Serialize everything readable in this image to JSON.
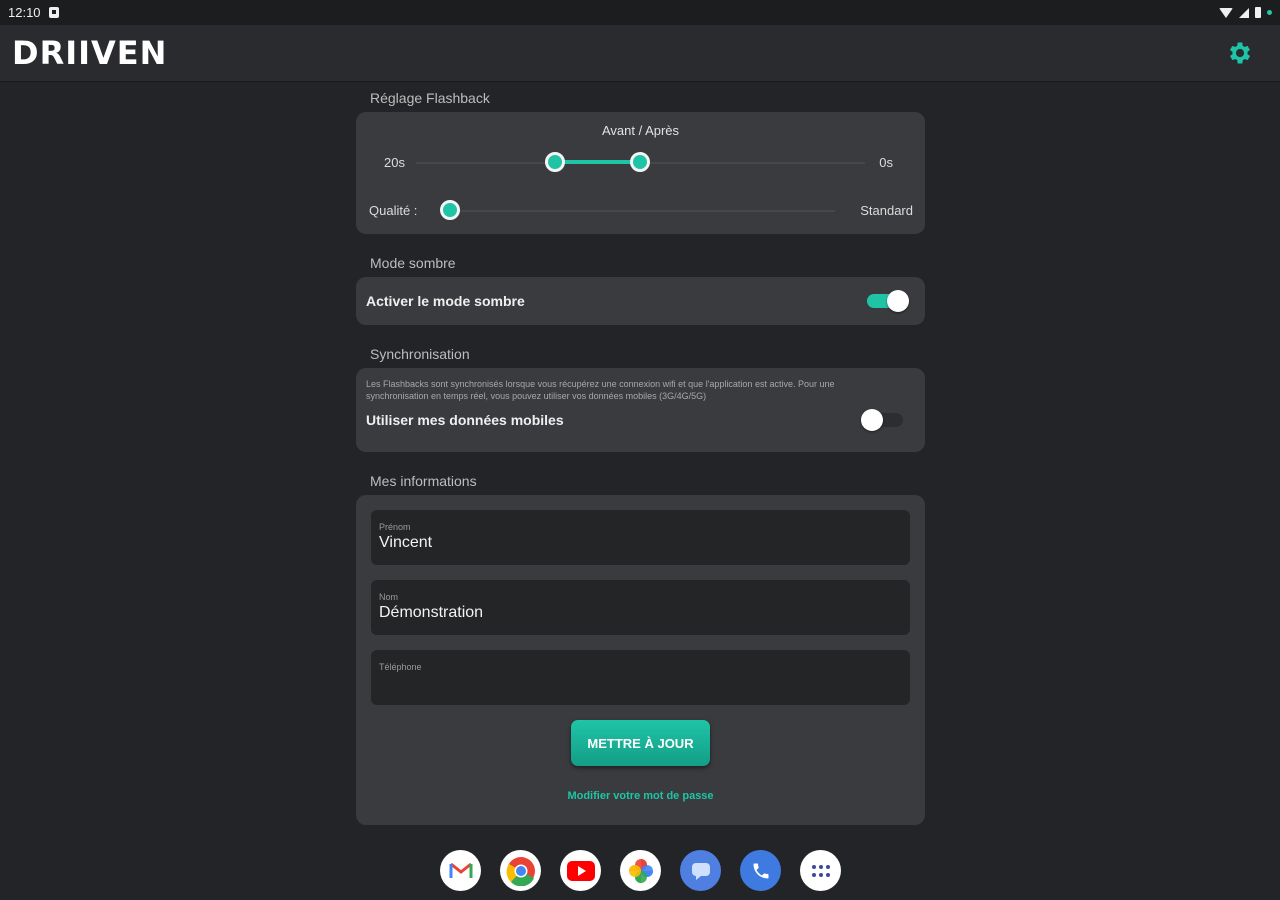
{
  "status_bar": {
    "time": "12:10"
  },
  "app_bar": {
    "logo_text": "DRIIVEN",
    "settings_icon": "gear-icon"
  },
  "flashback": {
    "section_title": "Réglage Flashback",
    "range_label": "Avant / Après",
    "before_value": "20s",
    "after_value": "0s",
    "quality_label": "Qualité :",
    "quality_value": "Standard"
  },
  "dark_mode": {
    "section_title": "Mode sombre",
    "toggle_label": "Activer le mode sombre",
    "enabled": true
  },
  "sync": {
    "section_title": "Synchronisation",
    "description": "Les Flashbacks sont synchronisés lorsque vous récupérez une connexion wifi et que l'application est active. Pour une synchronisation en temps réel, vous pouvez utiliser vos données mobiles (3G/4G/5G)",
    "toggle_label": "Utiliser mes données mobiles",
    "enabled": false
  },
  "info": {
    "section_title": "Mes informations",
    "first_name_label": "Prénom",
    "first_name_value": "Vincent",
    "last_name_label": "Nom",
    "last_name_value": "Démonstration",
    "phone_label": "Téléphone",
    "phone_value": "",
    "update_button": "METTRE À JOUR",
    "password_link": "Modifier votre mot de passe"
  },
  "dock": [
    "gmail-icon",
    "chrome-icon",
    "youtube-icon",
    "photos-icon",
    "messages-icon",
    "phone-icon",
    "apps-icon"
  ],
  "colors": {
    "accent": "#1fc4a7",
    "background": "#232427",
    "card": "#3a3b3e"
  }
}
